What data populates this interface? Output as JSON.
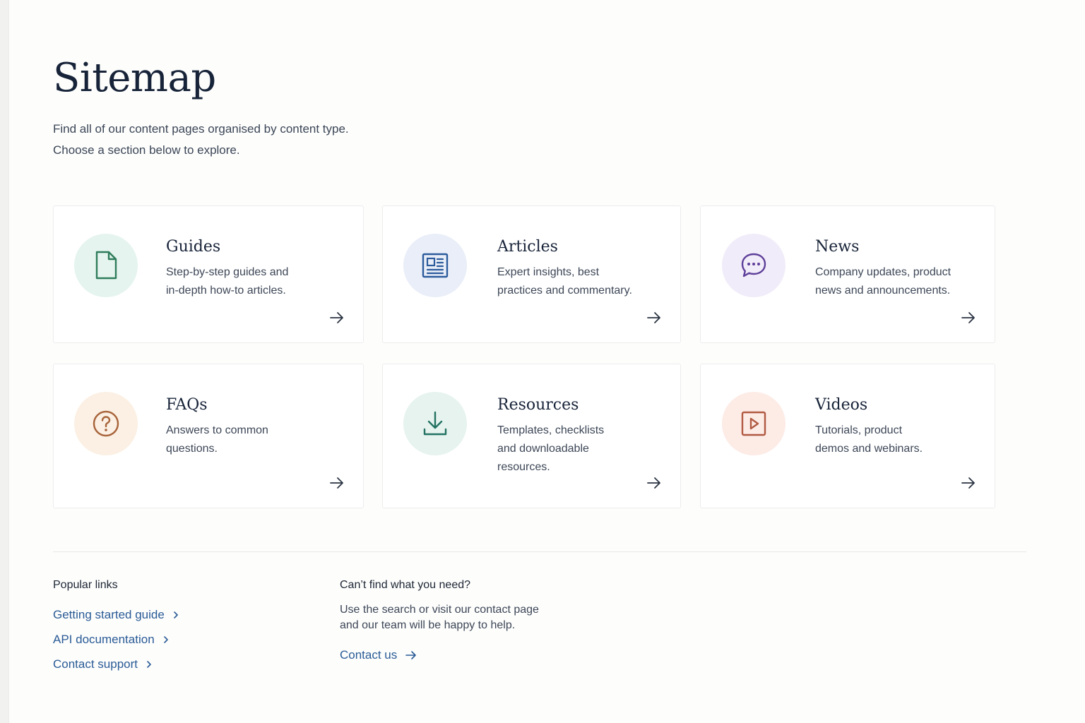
{
  "page": {
    "title": "Sitemap",
    "intro_line1": "Find all of our content pages organised by content type.",
    "intro_line2": "Choose a section below to explore."
  },
  "cards": [
    {
      "title": "Guides",
      "desc_line1": "Step-by-step guides and",
      "desc_line2": "in-depth how-to articles.",
      "desc_line3": "",
      "icon": "document-icon",
      "icon_color": "#2f7d5c",
      "circle_color": "#e5f4ee"
    },
    {
      "title": "Articles",
      "desc_line1": "Expert insights, best",
      "desc_line2": "practices and commentary.",
      "desc_line3": "",
      "icon": "newspaper-icon",
      "icon_color": "#2c5b9c",
      "circle_color": "#e9eef8"
    },
    {
      "title": "News",
      "desc_line1": "Company updates, product",
      "desc_line2": "news and announcements.",
      "desc_line3": "",
      "icon": "chat-bubble-icon",
      "icon_color": "#5e3f9a",
      "circle_color": "#f1ecf9"
    },
    {
      "title": "FAQs",
      "desc_line1": "Answers to common",
      "desc_line2": "questions.",
      "desc_line3": "",
      "icon": "question-circle-icon",
      "icon_color": "#a8633a",
      "circle_color": "#fbf0e3"
    },
    {
      "title": "Resources",
      "desc_line1": "Templates, checklists",
      "desc_line2": "and downloadable",
      "desc_line3": "resources.",
      "icon": "download-icon",
      "icon_color": "#237262",
      "circle_color": "#e6f3ef"
    },
    {
      "title": "Videos",
      "desc_line1": "Tutorials, product",
      "desc_line2": "demos and webinars.",
      "desc_line3": "",
      "icon": "play-video-icon",
      "icon_color": "#b15a42",
      "circle_color": "#fdebe6"
    }
  ],
  "footer": {
    "popular_heading": "Popular links",
    "links": [
      {
        "label": "Getting started guide"
      },
      {
        "label": "API documentation"
      },
      {
        "label": "Contact support"
      }
    ],
    "help_heading": "Can’t find what you need?",
    "help_line1": "Use the search or visit our contact page",
    "help_line2": "and our team will be happy to help.",
    "contact_label": "Contact us"
  },
  "colors": {
    "link": "#2a5b96",
    "heading": "#172338"
  }
}
